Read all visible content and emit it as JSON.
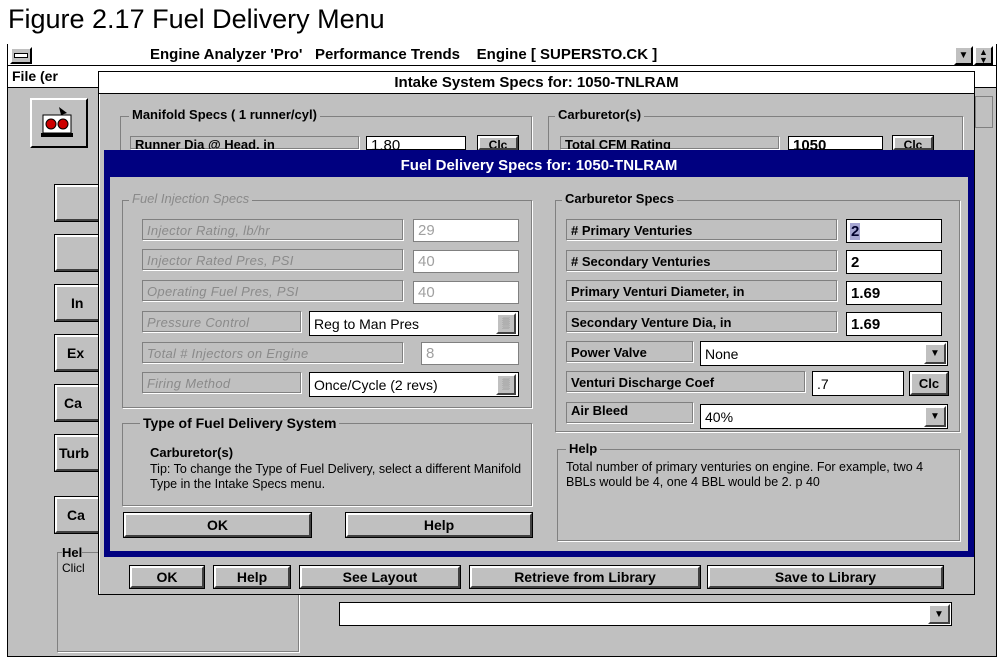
{
  "figure_caption": "Figure 2.17   Fuel Delivery Menu",
  "main_window": {
    "title": "Engine Analyzer 'Pro'   Performance Trends    Engine [ SUPERSTO.CK ]",
    "menu_file": "File (er",
    "left_buttons": [
      "In",
      "Ex",
      "Ca",
      "Turb",
      "Ca"
    ],
    "help_title": "Hel",
    "help_text": "Clicl"
  },
  "intake_dialog": {
    "title": "Intake System Specs for: 1050-TNLRAM",
    "manifold_title": "Manifold Specs ( 1 runner/cyl)",
    "runner_label": "Runner Dia @ Head, in",
    "runner_value": "1.80",
    "clc": "Clc",
    "carb_title": "Carburetor(s)",
    "cfm_label": "Total CFM Rating",
    "cfm_value": "1050",
    "buttons": {
      "ok": "OK",
      "help": "Help",
      "see_layout": "See Layout",
      "retrieve": "Retrieve from Library",
      "save": "Save to Library"
    }
  },
  "fuel_dialog": {
    "title": "Fuel Delivery Specs for: 1050-TNLRAM",
    "injection": {
      "title": "Fuel Injection Specs",
      "injector_rating_label": "Injector Rating, lb/hr",
      "injector_rating_value": "29",
      "injector_pres_label": "Injector Rated Pres, PSI",
      "injector_pres_value": "40",
      "operating_pres_label": "Operating Fuel Pres, PSI",
      "operating_pres_value": "40",
      "pressure_control_label": "Pressure Control",
      "pressure_control_value": "Reg to Man Pres",
      "total_injectors_label": "Total # Injectors on Engine",
      "total_injectors_value": "8",
      "firing_method_label": "Firing Method",
      "firing_method_value": "Once/Cycle (2 revs)"
    },
    "type_box": {
      "title": "Type of Fuel Delivery System",
      "carb_label": "Carburetor(s)",
      "tip": "Tip:  To change the Type of Fuel Delivery, select a different Manifold Type in the Intake Specs menu."
    },
    "carb": {
      "title": "Carburetor Specs",
      "primary_label": "# Primary Venturies",
      "primary_value": "2",
      "secondary_label": "# Secondary Venturies",
      "secondary_value": "2",
      "primary_dia_label": "Primary Venturi Diameter, in",
      "primary_dia_value": "1.69",
      "secondary_dia_label": "Secondary Venture Dia, in",
      "secondary_dia_value": "1.69",
      "power_valve_label": "Power Valve",
      "power_valve_value": "None",
      "discharge_label": "Venturi Discharge Coef",
      "discharge_value": ".7",
      "clc": "Clc",
      "air_bleed_label": "Air Bleed",
      "air_bleed_value": "40%"
    },
    "help": {
      "title": "Help",
      "text": "Total number of primary venturies on engine.  For example, two 4 BBLs would be 4, one 4 BBL would be 2.  p 40"
    },
    "ok": "OK",
    "help_button": "Help"
  }
}
